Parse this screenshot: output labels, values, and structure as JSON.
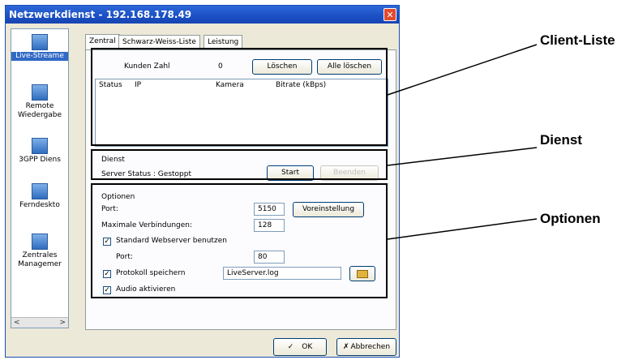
{
  "window": {
    "title": "Netzwerkdienst - 192.168.178.49",
    "close_label": "✕"
  },
  "sidebar": {
    "items": [
      {
        "label": "Live-Streame",
        "icon": "monitor-icon",
        "selected": true
      },
      {
        "label": "Remote Wiedergabe",
        "icon": "play-icon",
        "selected": false
      },
      {
        "label": "3GPP Diens",
        "icon": "mobile-phone-icon",
        "selected": false
      },
      {
        "label": "Ferndeskto",
        "icon": "remote-desktop-icon",
        "selected": false
      },
      {
        "label": "Zentrales Managemer",
        "icon": "keyboard-icon",
        "selected": false
      }
    ],
    "scroll_left": "<",
    "scroll_right": ">"
  },
  "tabs": [
    {
      "label": "Zentral",
      "active": true
    },
    {
      "label": "Schwarz-Weiss-Liste",
      "active": false
    },
    {
      "label": "Leistung",
      "active": false
    }
  ],
  "clients": {
    "count_label": "Kunden Zahl",
    "count_value": "0",
    "delete_label": "Löschen",
    "delete_all_label": "Alle löschen",
    "columns": [
      "Status",
      "IP",
      "Kamera",
      "Bitrate (kBps)"
    ]
  },
  "service": {
    "group_label": "Dienst",
    "status_text": "Server Status : Gestoppt",
    "start_label": "Start",
    "stop_label": "Beenden"
  },
  "options": {
    "group_label": "Optionen",
    "port_label": "Port:",
    "port_value": "5150",
    "preset_label": "Voreinstellung",
    "max_conn_label": "Maximale Verbindungen:",
    "max_conn_value": "128",
    "webserver_label": "Standard Webserver benutzen",
    "webserver_checked": true,
    "webserver_port_label": "Port:",
    "webserver_port_value": "80",
    "log_label": "Protokoll speichern",
    "log_checked": true,
    "log_file": "LiveServer.log",
    "audio_label": "Audio aktivieren",
    "audio_checked": true
  },
  "footer": {
    "ok_label": "OK",
    "cancel_label": "Abbrechen"
  },
  "callouts": {
    "client_list": "Client-Liste",
    "service": "Dienst",
    "options": "Optionen"
  }
}
